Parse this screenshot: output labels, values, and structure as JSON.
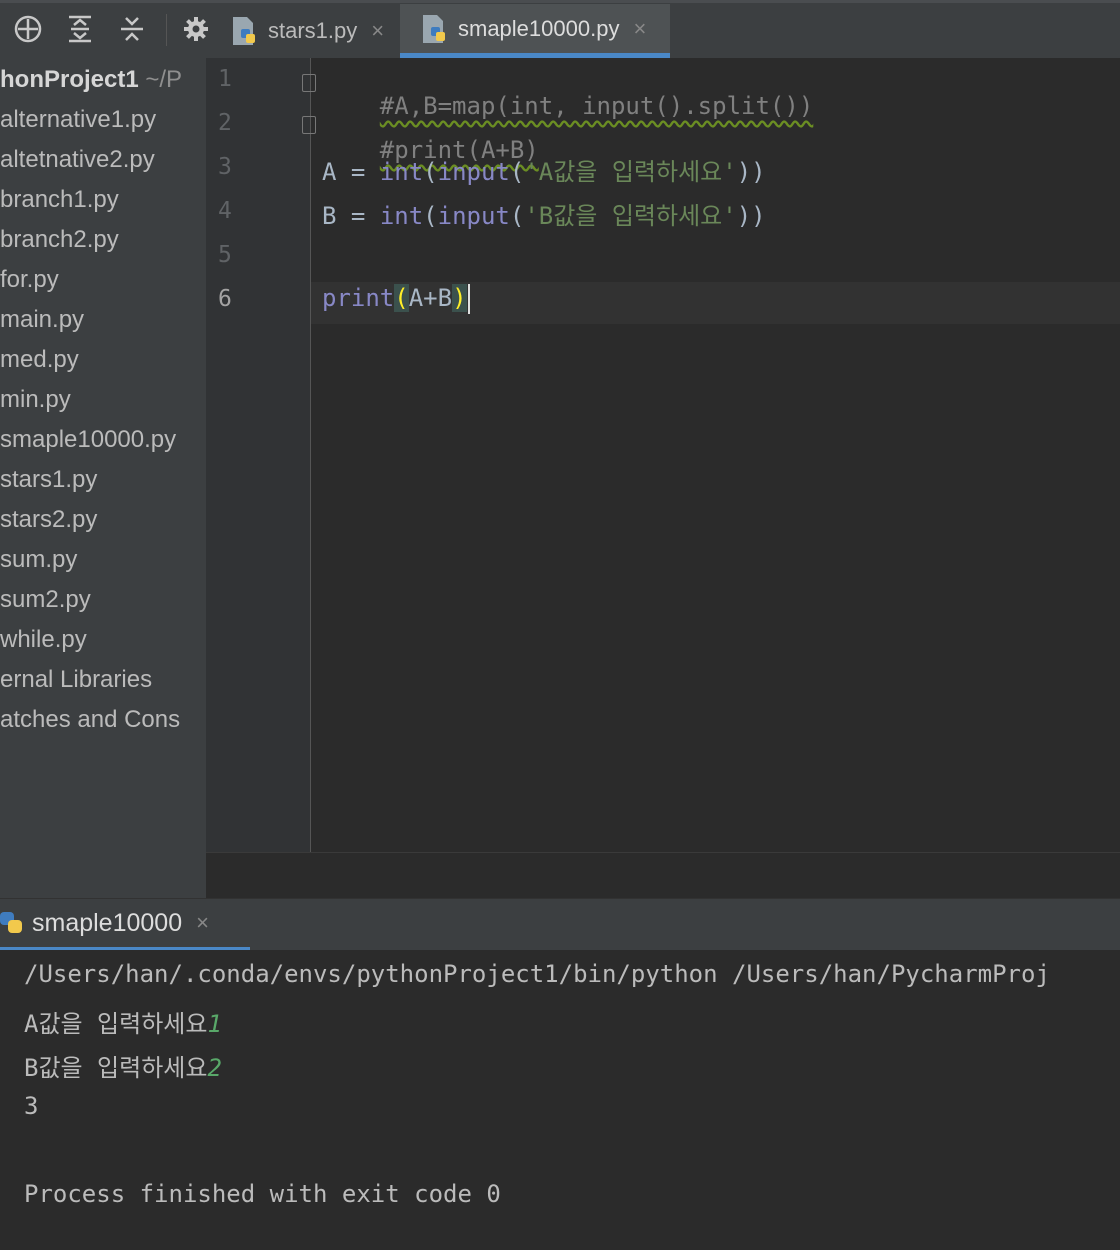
{
  "toolbar": {
    "icons": [
      "locate-icon",
      "expand-all-icon",
      "collapse-all-icon",
      "gear-icon"
    ]
  },
  "tabs": [
    {
      "label": "stars1.py",
      "active": false,
      "close": "×"
    },
    {
      "label": "smaple10000.py",
      "active": true,
      "close": "×"
    }
  ],
  "project": {
    "root_name": "honProject1",
    "root_path": "~/P",
    "files": [
      "alternative1.py",
      "altetnative2.py",
      "branch1.py",
      "branch2.py",
      "for.py",
      "main.py",
      "med.py",
      "min.py",
      "smaple10000.py",
      "stars1.py",
      "stars2.py",
      "sum.py",
      "sum2.py",
      "while.py",
      "ernal Libraries",
      "atches and Cons"
    ]
  },
  "editor": {
    "line_numbers": [
      "1",
      "2",
      "3",
      "4",
      "5",
      "6"
    ],
    "line1": "#A,B=map(int, input().split())",
    "line2": "#print(A+B)",
    "line3": {
      "var": "A",
      "eq": " = ",
      "f1": "int",
      "p1": "(",
      "f2": "input",
      "p2": "(",
      "s": "'A값을 입력하세요'",
      "end": "))"
    },
    "line4": {
      "var": "B",
      "eq": " = ",
      "f1": "int",
      "p1": "(",
      "f2": "input",
      "p2": "(",
      "s": "'B값을 입력하세요'",
      "end": "))"
    },
    "line6": {
      "f": "print",
      "open": "(",
      "args": "A+B",
      "close": ")"
    }
  },
  "run": {
    "tab_label": "smaple10000",
    "close": "×",
    "command": "/Users/han/.conda/envs/pythonProject1/bin/python /Users/han/PycharmProj",
    "prompt1": "A값을 입력하세요",
    "input1": "1",
    "prompt2": "B값을 입력하세요",
    "input2": "2",
    "output": "3",
    "finished": "Process finished with exit code 0"
  }
}
